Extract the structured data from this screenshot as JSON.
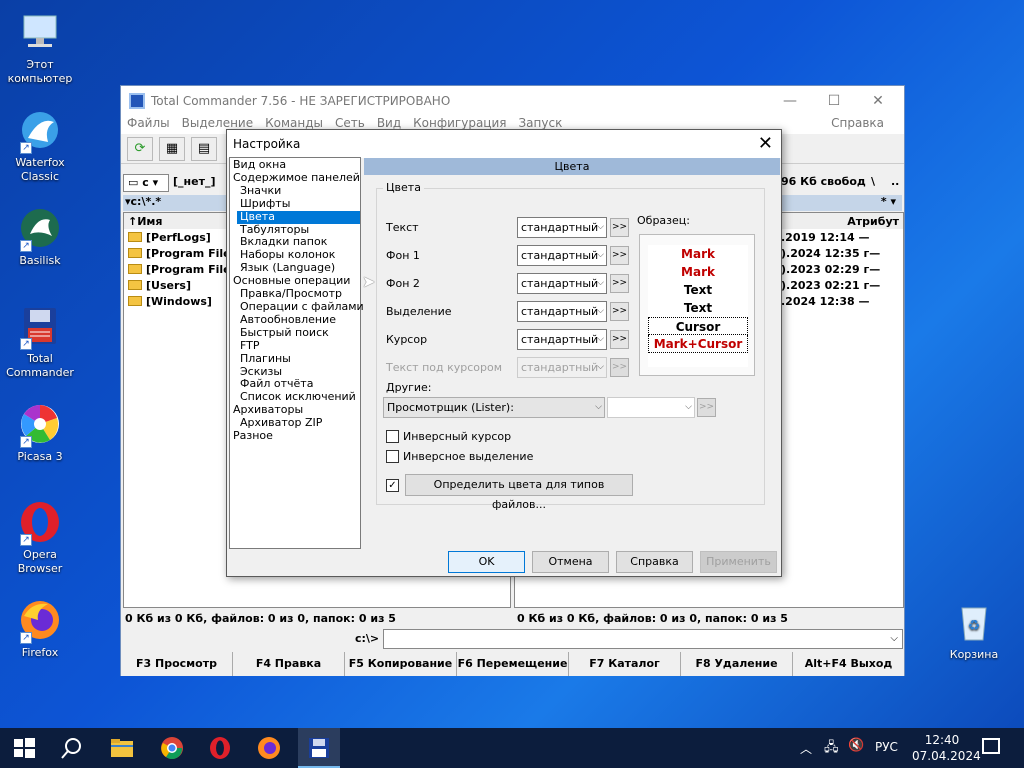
{
  "desktop": {
    "icons": [
      {
        "label": "Этот компьютер",
        "icon": "computer-icon"
      },
      {
        "label": "Waterfox Classic",
        "icon": "waterfox-icon"
      },
      {
        "label": "Basilisk",
        "icon": "basilisk-icon"
      },
      {
        "label": "Total Commander",
        "icon": "total-commander-icon"
      },
      {
        "label": "Picasa 3",
        "icon": "picasa-icon"
      },
      {
        "label": "Opera Browser",
        "icon": "opera-icon"
      },
      {
        "label": "Firefox",
        "icon": "firefox-icon"
      },
      {
        "label": "Корзина",
        "icon": "recycle-bin-icon"
      }
    ]
  },
  "tc": {
    "title": "Total Commander 7.56 - НЕ ЗАРЕГИСТРИРОВАНО",
    "menu": [
      "Файлы",
      "Выделение",
      "Команды",
      "Сеть",
      "Вид",
      "Конфигурация",
      "Запуск"
    ],
    "menu_help": "Справка",
    "drive": "c",
    "drive_label": "[_нет_]",
    "free_space": "96 Кб свобод",
    "path": "c:\\*.*",
    "col_name": "↑Имя",
    "col_attr": "Атрибут",
    "files": [
      "[PerfLogs]",
      "[Program Files]",
      "[Program Files",
      "[Users]",
      "[Windows]"
    ],
    "dates": [
      ".2019 12:14 —",
      ").2024 12:35 г—",
      ").2023 02:29 г—",
      ").2023 02:21 г—",
      ".2024 12:38 —"
    ],
    "status_left": "0 Кб из 0 Кб, файлов: 0 из 0, папок: 0 из 5",
    "status_right": "0 Кб из 0 Кб, файлов: 0 из 0, папок: 0 из 5",
    "cmd_label": "c:\\>",
    "fkeys": [
      "F3 Просмотр",
      "F4 Правка",
      "F5 Копирование",
      "F6 Перемещение",
      "F7 Каталог",
      "F8 Удаление",
      "Alt+F4 Выход"
    ]
  },
  "dialog": {
    "title": "Настройка",
    "tree": [
      {
        "label": "Вид окна",
        "level": 0
      },
      {
        "label": "Содержимое панелей",
        "level": 0
      },
      {
        "label": "Значки",
        "level": 1
      },
      {
        "label": "Шрифты",
        "level": 1
      },
      {
        "label": "Цвета",
        "level": 1,
        "selected": true
      },
      {
        "label": "Табуляторы",
        "level": 1
      },
      {
        "label": "Вкладки папок",
        "level": 1
      },
      {
        "label": "Наборы колонок",
        "level": 1
      },
      {
        "label": "Язык (Language)",
        "level": 1
      },
      {
        "label": "Основные операции",
        "level": 0
      },
      {
        "label": "Правка/Просмотр",
        "level": 1
      },
      {
        "label": "Операции с файлами",
        "level": 1
      },
      {
        "label": "Автообновление",
        "level": 1
      },
      {
        "label": "Быстрый поиск",
        "level": 1
      },
      {
        "label": "FTP",
        "level": 1
      },
      {
        "label": "Плагины",
        "level": 1
      },
      {
        "label": "Эскизы",
        "level": 1
      },
      {
        "label": "Файл отчёта",
        "level": 1
      },
      {
        "label": "Список исключений",
        "level": 1
      },
      {
        "label": "Архиваторы",
        "level": 0
      },
      {
        "label": "Архиватор ZIP",
        "level": 1
      },
      {
        "label": "Разное",
        "level": 0
      }
    ],
    "section_header": "Цвета",
    "group_label": "Цвета",
    "rows": [
      {
        "label": "Текст",
        "value": "стандартный"
      },
      {
        "label": "Фон 1",
        "value": "стандартный"
      },
      {
        "label": "Фон 2",
        "value": "стандартный"
      },
      {
        "label": "Выделение",
        "value": "стандартный"
      },
      {
        "label": "Курсор",
        "value": "стандартный"
      },
      {
        "label": "Текст под курсором",
        "value": "стандартный",
        "disabled": true
      }
    ],
    "more_btn": ">>",
    "sample_label": "Образец:",
    "sample_rows": [
      "Mark",
      "Mark",
      "Text",
      "Text",
      "Cursor",
      "Mark+Cursor"
    ],
    "other_label": "Другие:",
    "other_value": "Просмотрщик (Lister):",
    "other_color": "",
    "cb_inverse_cursor": "Инверсный курсор",
    "cb_inverse_selection": "Инверсное выделение",
    "define_colors": "Определить цвета для типов файлов...",
    "ok": "OK",
    "cancel": "Отмена",
    "help": "Справка",
    "apply": "Применить",
    "colors": {
      "mark": "#c00000",
      "selection_bg": "#0078d7",
      "header_bg": "#9fb9d9"
    }
  },
  "taskbar": {
    "lang": "РУС",
    "time": "12:40",
    "date": "07.04.2024"
  }
}
